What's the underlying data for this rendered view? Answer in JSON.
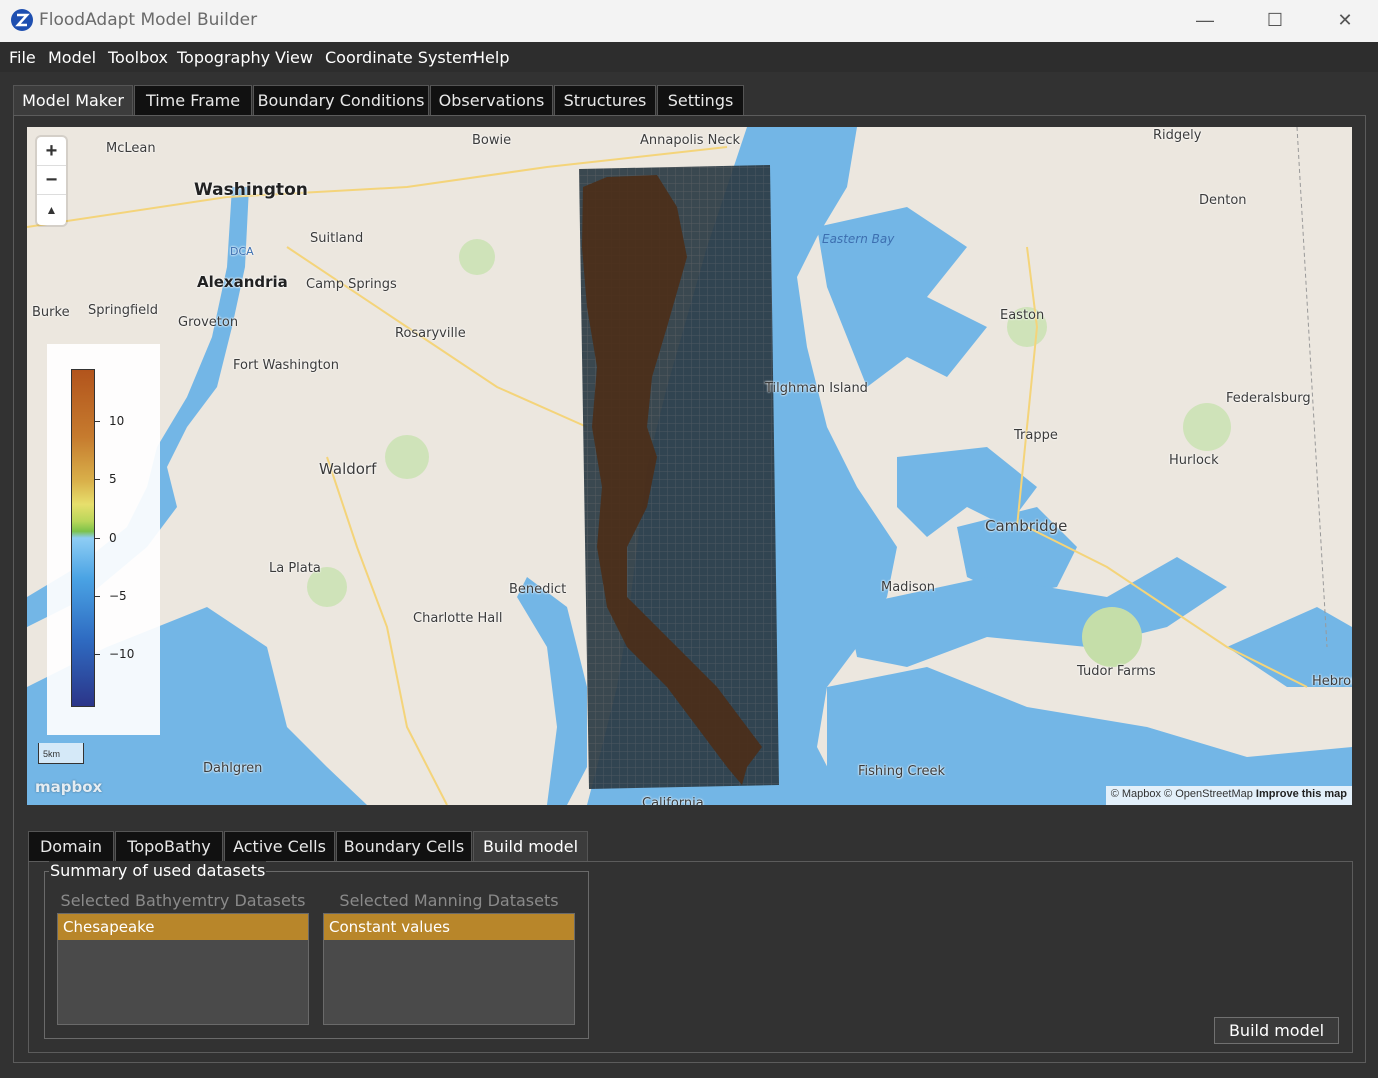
{
  "window": {
    "title": "FloodAdapt Model Builder",
    "minimize": "—",
    "maximize": "☐",
    "close": "✕"
  },
  "menu": [
    "File",
    "Model",
    "Toolbox",
    "Topography",
    "View",
    "Coordinate System",
    "Help"
  ],
  "tabs": [
    "Model Maker",
    "Time Frame",
    "Boundary Conditions",
    "Observations",
    "Structures",
    "Settings"
  ],
  "active_tab": "Model Maker",
  "map": {
    "labels": {
      "washington": "Washington",
      "alexandria": "Alexandria",
      "mclean": "McLean",
      "bowie": "Bowie",
      "annapolis_neck": "Annapolis Neck",
      "ridgely": "Ridgely",
      "denton": "Denton",
      "suitland": "Suitland",
      "camp_springs": "Camp Springs",
      "springfield": "Springfield",
      "burke": "Burke",
      "groveton": "Groveton",
      "rosaryville": "Rosaryville",
      "fort_washington": "Fort Washington",
      "eastern_bay": "Eastern Bay",
      "easton": "Easton",
      "tilghman_island": "Tilghman Island",
      "federalsburg": "Federalsburg",
      "trappe": "Trappe",
      "hurlock": "Hurlock",
      "waldorf": "Waldorf",
      "cambridge": "Cambridge",
      "la_plata": "La Plata",
      "benedict": "Benedict",
      "charlotte_hall": "Charlotte Hall",
      "madison": "Madison",
      "tudor_farms": "Tudor Farms",
      "hebron": "Hebron",
      "fishing_creek": "Fishing Creek",
      "dahlgren": "Dahlgren",
      "california": "California",
      "dca": "DCA"
    },
    "zoom_in": "+",
    "zoom_out": "−",
    "compass": "▲",
    "scale": "5km",
    "logo": "mapbox",
    "attribution": "© Mapbox © OpenStreetMap",
    "improve": "Improve this map",
    "colorbar_ticks": [
      "10",
      "5",
      "0",
      "−5",
      "−10"
    ],
    "colorbar_range": [
      -13,
      14
    ]
  },
  "subtabs": [
    "Domain",
    "TopoBathy",
    "Active Cells",
    "Boundary Cells",
    "Build model"
  ],
  "active_subtab": "Build model",
  "summary": {
    "title": "Summary of used datasets",
    "bathy_header": "Selected Bathyemtry Datasets",
    "bathy_items": [
      "Chesapeake"
    ],
    "manning_header": "Selected Manning Datasets",
    "manning_items": [
      "Constant values"
    ]
  },
  "build_button": "Build model",
  "colors": {
    "accent": "#b8862a",
    "water": "#73b6e6",
    "land": "#ece7df",
    "panel": "#323232"
  }
}
